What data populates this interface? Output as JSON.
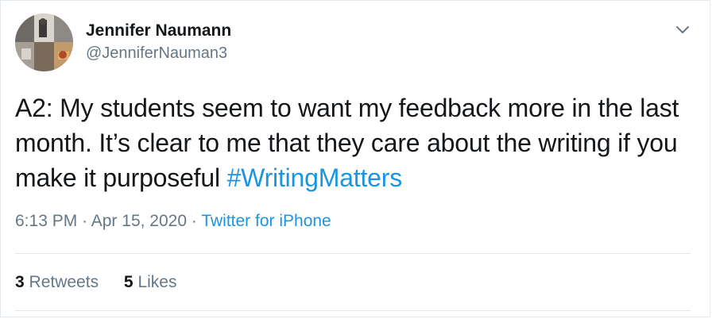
{
  "user": {
    "display_name": "Jennifer Naumann",
    "handle": "@JenniferNauman3"
  },
  "tweet": {
    "text": "A2: My students seem to want my feedback more in the last month. It’s clear to me that they care about the writing if you make it purposeful ",
    "hashtag": "#WritingMatters"
  },
  "meta": {
    "time": "6:13 PM",
    "separator": "·",
    "date": "Apr 15, 2020",
    "source": "Twitter for iPhone"
  },
  "stats": {
    "retweets_count": "3",
    "retweets_label": "Retweets",
    "likes_count": "5",
    "likes_label": "Likes"
  },
  "icons": {
    "menu": "chevron-down-icon"
  },
  "colors": {
    "link": "#1b95e0",
    "secondary_text": "#657786",
    "primary_text": "#14171a",
    "divider": "#e1e8ed"
  }
}
